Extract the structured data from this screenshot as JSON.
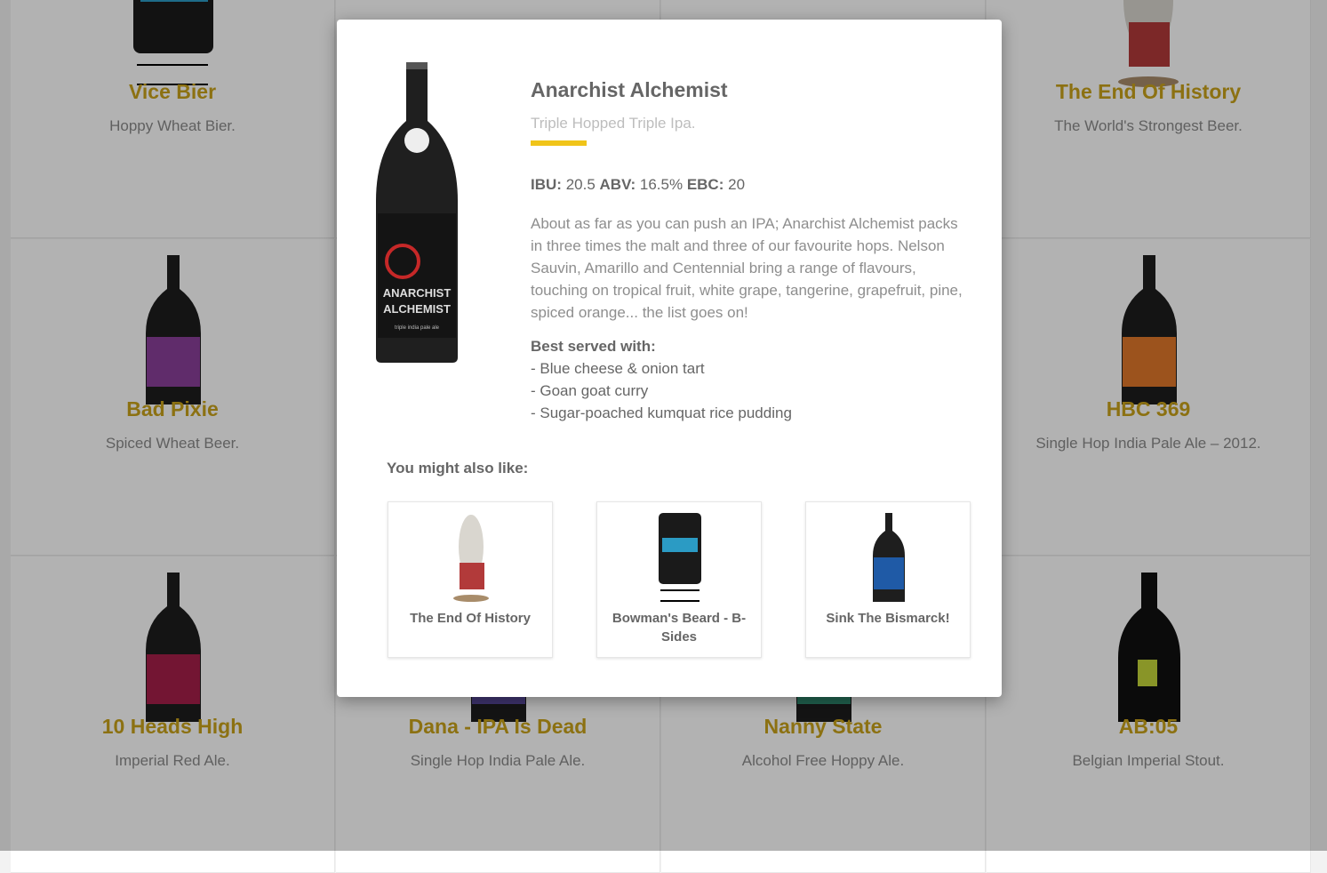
{
  "grid": {
    "products": [
      {
        "name": "Vice Bier",
        "tagline": "Hoppy Wheat Bier."
      },
      {
        "name": "",
        "tagline": ""
      },
      {
        "name": "",
        "tagline": ""
      },
      {
        "name": "The End Of History",
        "tagline": "The World's Strongest Beer."
      },
      {
        "name": "Bad Pixie",
        "tagline": "Spiced Wheat Beer."
      },
      {
        "name": "",
        "tagline": ""
      },
      {
        "name": "",
        "tagline": ""
      },
      {
        "name": "HBC 369",
        "tagline": "Single Hop India Pale Ale – 2012."
      },
      {
        "name": "10 Heads High",
        "tagline": "Imperial Red Ale."
      },
      {
        "name": "Dana - IPA Is Dead",
        "tagline": "Single Hop India Pale Ale."
      },
      {
        "name": "Nanny State",
        "tagline": "Alcohol Free Hoppy Ale."
      },
      {
        "name": "AB:05",
        "tagline": "Belgian Imperial Stout."
      }
    ]
  },
  "modal": {
    "title": "Anarchist Alchemist",
    "tagline": "Triple Hopped Triple Ipa.",
    "stats": {
      "ibu_label": "IBU:",
      "ibu": "20.5",
      "abv_label": "ABV:",
      "abv": "16.5%",
      "ebc_label": "EBC:",
      "ebc": "20"
    },
    "description": "About as far as you can push an IPA; Anarchist Alchemist packs in three times the malt and three of our favourite hops. Nelson Sauvin, Amarillo and Centennial bring a range of flavours, touching on tropical fruit, white grape, tangerine, grapefruit, pine, spiced orange... the list goes on!",
    "pairing_label": "Best served with:",
    "pairings": [
      "- Blue cheese & onion tart",
      "- Goan goat curry",
      "- Sugar-poached kumquat rice pudding"
    ],
    "also_label": "You might also like:",
    "suggestions": [
      {
        "name": "The End Of History"
      },
      {
        "name": "Bowman's Beard - B-Sides"
      },
      {
        "name": "Sink The Bismarck!"
      }
    ],
    "main_bottle_label": {
      "lines": [
        "ANARCHIST",
        "ALCHEMIST"
      ],
      "sub": "triple india pale ale"
    }
  },
  "colors": {
    "accent": "#f0c419",
    "name": "#c9a31a",
    "text": "#666666"
  }
}
